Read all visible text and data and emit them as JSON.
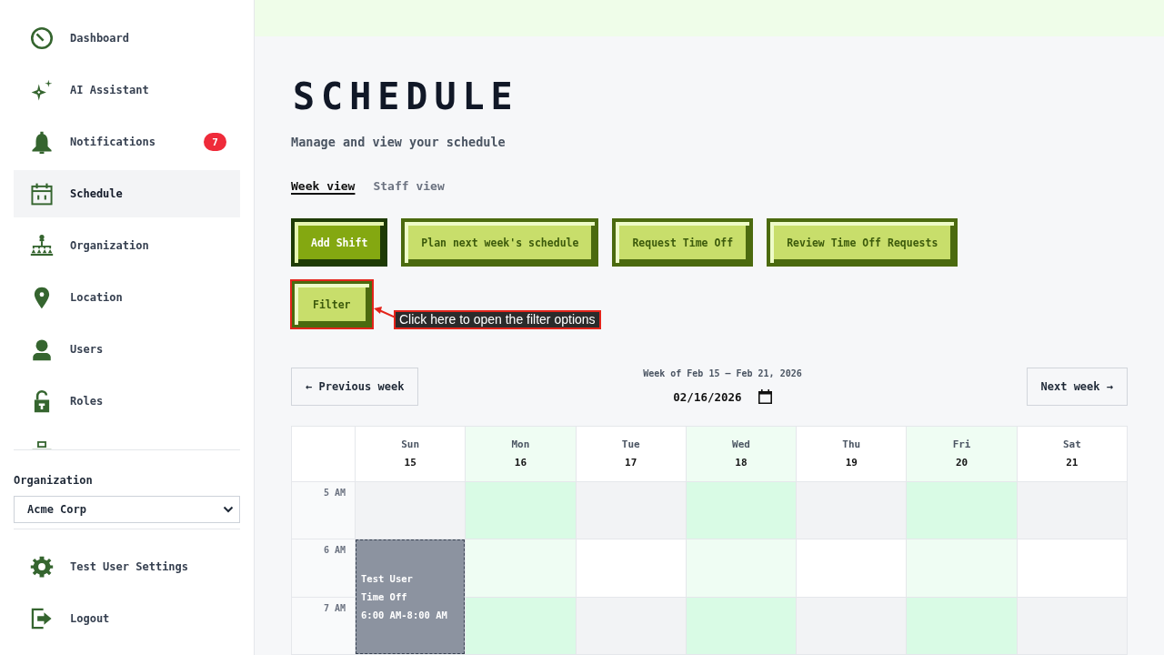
{
  "sidebar": {
    "nav_items": [
      {
        "label": "Dashboard",
        "selected": false
      },
      {
        "label": "AI Assistant",
        "selected": false
      },
      {
        "label": "Notifications",
        "selected": false,
        "badge": "7"
      },
      {
        "label": "Schedule",
        "selected": true
      },
      {
        "label": "Organization",
        "selected": false
      },
      {
        "label": "Location",
        "selected": false
      },
      {
        "label": "Users",
        "selected": false
      },
      {
        "label": "Roles",
        "selected": false
      }
    ],
    "organization": {
      "label": "Organization",
      "value": "Acme Corp"
    },
    "footer_items": [
      {
        "label": "Test User Settings"
      },
      {
        "label": "Logout"
      }
    ]
  },
  "page": {
    "title": "SCHEDULE",
    "subtitle": "Manage and view your schedule"
  },
  "view_tabs": [
    {
      "label": "Week view",
      "selected": true
    },
    {
      "label": "Staff view",
      "selected": false
    }
  ],
  "actions": [
    {
      "label": "Add Shift",
      "kind": "primary"
    },
    {
      "label": "Plan next week's schedule",
      "kind": "secondary"
    },
    {
      "label": "Request Time Off",
      "kind": "secondary"
    },
    {
      "label": "Review Time Off Requests",
      "kind": "secondary"
    }
  ],
  "filter_button": {
    "label": "Filter",
    "highlighted": true
  },
  "annotation": {
    "text": "Click here to open the filter options"
  },
  "week_nav": {
    "previous": "← Previous week",
    "range": "Week of Feb 15 – Feb 21, 2026",
    "date": "02/16/2026",
    "next": "Next week →"
  },
  "calendar": {
    "hours": [
      {
        "label": "5 AM"
      },
      {
        "label": "6 AM"
      },
      {
        "label": "7 AM"
      }
    ],
    "days": [
      {
        "name": "Sun",
        "date": "15",
        "highlighted": false,
        "slots": [
          {
            "kind": "free"
          },
          {
            "kind": "event",
            "person": "Test User",
            "type": "Time Off",
            "time": "6:00 AM-8:00 AM"
          },
          {
            "kind": "continued"
          }
        ]
      },
      {
        "name": "Mon",
        "date": "16",
        "highlighted": true,
        "slots": [
          {
            "kind": "free"
          },
          {
            "kind": "free"
          },
          {
            "kind": "free"
          }
        ]
      },
      {
        "name": "Tue",
        "date": "17",
        "highlighted": false,
        "slots": [
          {
            "kind": "free"
          },
          {
            "kind": "free"
          },
          {
            "kind": "free"
          }
        ]
      },
      {
        "name": "Wed",
        "date": "18",
        "highlighted": true,
        "slots": [
          {
            "kind": "free"
          },
          {
            "kind": "free"
          },
          {
            "kind": "free"
          }
        ]
      },
      {
        "name": "Thu",
        "date": "19",
        "highlighted": false,
        "slots": [
          {
            "kind": "free"
          },
          {
            "kind": "free"
          },
          {
            "kind": "free"
          }
        ]
      },
      {
        "name": "Fri",
        "date": "20",
        "highlighted": true,
        "slots": [
          {
            "kind": "free"
          },
          {
            "kind": "free"
          },
          {
            "kind": "free"
          }
        ]
      },
      {
        "name": "Sat",
        "date": "21",
        "highlighted": false,
        "slots": [
          {
            "kind": "free"
          },
          {
            "kind": "free"
          },
          {
            "kind": "free"
          }
        ]
      }
    ]
  }
}
